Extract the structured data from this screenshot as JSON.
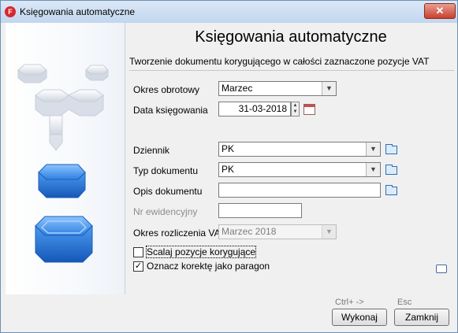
{
  "window": {
    "title": "Księgowania automatyczne",
    "app_icon_letter": "F",
    "close_symbol": "✕"
  },
  "header": {
    "title": "Księgowania automatyczne",
    "subtitle": "Tworzenie dokumentu korygującego w całości zaznaczone pozycje VAT"
  },
  "form": {
    "okres_label": "Okres obrotowy",
    "okres_value": "Marzec",
    "data_label": "Data księgowania",
    "data_value": "31-03-2018",
    "dziennik_label": "Dziennik",
    "dziennik_value": "PK",
    "typ_label": "Typ dokumentu",
    "typ_value": "PK",
    "opis_label": "Opis dokumentu",
    "opis_value": "",
    "nr_label": "Nr ewidencyjny",
    "nr_value": "",
    "okres_vat_label": "Okres rozliczenia VAT",
    "okres_vat_value": "Marzec 2018",
    "scalaj_label": "Scalaj pozycje korygujące",
    "scalaj_checked": false,
    "oznacz_label": "Oznacz korektę jako paragon",
    "oznacz_checked": true,
    "dropdown_arrow": "▼",
    "spin_up": "▲",
    "spin_down": "▼",
    "check_mark": "✓"
  },
  "footer": {
    "wykonaj_hint": "Ctrl+ ->",
    "wykonaj_label": "Wykonaj",
    "zamknij_hint": "Esc",
    "zamknij_label": "Zamknij"
  },
  "icons": [
    "app-logo-icon",
    "close-icon",
    "dropdown-arrow-icon",
    "calendar-icon",
    "folder-icon",
    "comment-icon",
    "spin-up-icon",
    "spin-down-icon"
  ],
  "colors": {
    "title_bar": "#c2d6ee",
    "close_button": "#c9402f",
    "accent_blue": "#1f6fd1",
    "disabled_text": "#8c8c8c"
  }
}
